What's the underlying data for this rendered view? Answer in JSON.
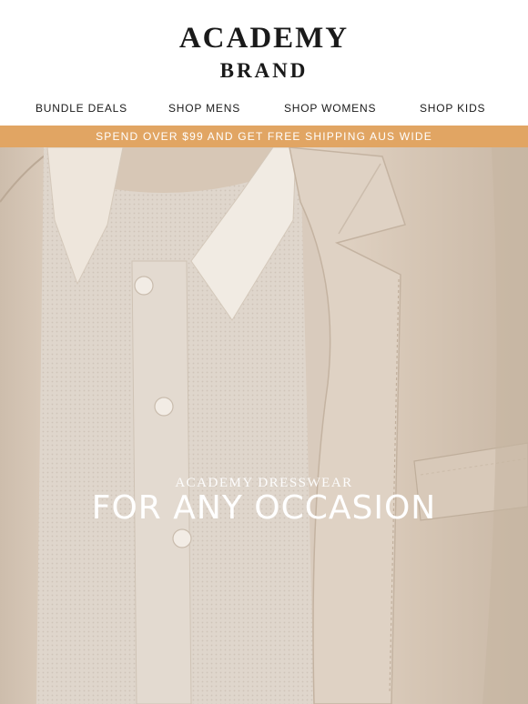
{
  "brand": {
    "line1": "ACADEMY",
    "line2": "BRAND"
  },
  "nav": [
    {
      "label": "BUNDLE DEALS"
    },
    {
      "label": "SHOP MENS"
    },
    {
      "label": "SHOP WOMENS"
    },
    {
      "label": "SHOP KIDS"
    }
  ],
  "promo": {
    "text": "SPEND OVER $99 AND GET FREE SHIPPING AUS WIDE",
    "color": "#e1a563"
  },
  "hero": {
    "subtitle": "ACADEMY DRESSWEAR",
    "title": "FOR ANY OCCASION"
  }
}
